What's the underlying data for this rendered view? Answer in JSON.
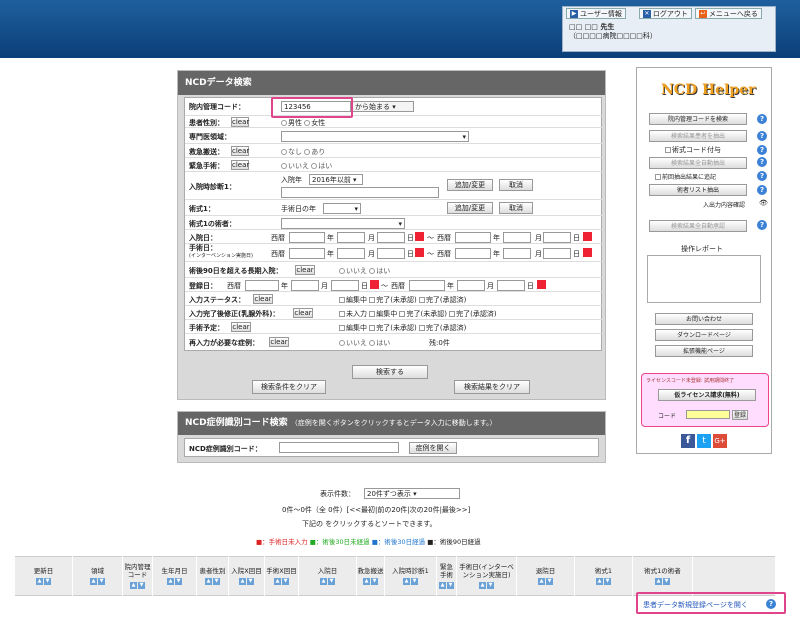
{
  "user": {
    "info_label": "ユーザー情報",
    "logout_label": "ログアウト",
    "menu_back_label": "メニューへ戻る",
    "name": "□□ □□ 先生",
    "hospital": "（□□□□病院□□□□科）"
  },
  "search": {
    "title": "NCDデータ検索",
    "hospital_code_label": "院内管理コード：",
    "hospital_code_value": "123456",
    "match_mode": "から始まる",
    "gender_label": "患者性別：",
    "clear": "clear",
    "male": "男性",
    "female": "女性",
    "specialty_label": "専門医領域：",
    "emergency_label": "救急搬送：",
    "none": "なし",
    "exists": "あり",
    "emergency_surgery_label": "緊急手術：",
    "no": "いいえ",
    "yes": "はい",
    "admission_diag_label": "入院時診断1：",
    "admission_year_label": "入院年",
    "admission_year_value": "2016年以前",
    "add_change": "追加/変更",
    "cancel": "取消",
    "procedure_label": "術式1：",
    "surgery_year_label": "手術日の年",
    "surgeon_label": "術式1の術者：",
    "admit_date_label": "入院日：",
    "seireki": "西暦",
    "year": "年",
    "month": "月",
    "day": "日",
    "tilde": "〜",
    "surgery_date_label": "手術日：",
    "surgery_date_sub": "(インターベンション実施日)",
    "long_stay_label": "術後90日を超える長期入院：",
    "reg_date_label": "登録日：",
    "input_status_label": "入力ステータス：",
    "editing": "編集中",
    "done_unapproved": "完了(未承認)",
    "done_approved": "完了(承認済)",
    "revision_label": "入力完了後修正(乳腺外科)：",
    "not_input": "未入力",
    "planned_label": "手術予定：",
    "reinput_label": "再入力が必要な症例：",
    "remaining": "残:0件",
    "search_button": "検索する",
    "clear_conditions": "検索条件をクリア",
    "clear_results": "検索結果をクリア"
  },
  "case_code": {
    "title": "NCD症例識別コード検索",
    "hint": "（症例を開くボタンをクリックするとデータ入力に移動します。）",
    "label": "NCD症例識別コード：",
    "open_button": "症例を開く"
  },
  "results": {
    "display_count_label": "表示件数：",
    "display_count_value": "20件ずつ表示",
    "summary": "0件〜0件（全 0件）[<<最初|前の20件|次の20件|最後>>]",
    "sort_hint": "下記の をクリックするとソートできます。",
    "legend": [
      "■：手術日未入力",
      "■：術後30日未経過",
      "■：術後30日経過",
      "■：術後90日経過"
    ],
    "headers": [
      "更新日",
      "領域",
      "院内管理コード",
      "生年月日",
      "患者性別",
      "入院X回目",
      "手術X回目",
      "入院日",
      "救急搬送",
      "入院時診断1",
      "緊急手術",
      "手術日(インターベンション実施日)",
      "退院日",
      "術式1",
      "術式1の術者"
    ],
    "new_patient_link": "患者データ新規登録ページを開く"
  },
  "helper": {
    "logo": "NCD Helper",
    "search_code": "院内管理コードを検索",
    "extract": "検索結果患者を抽出",
    "attach_code": "術式コード付与",
    "auto_extract": "検索結果全自動抽出",
    "append_note": "前回抽出結果に追記",
    "list_extract": "術者リスト抽出",
    "check_label": "入出力内容確認",
    "all_auto": "検索結果全自動承認",
    "report_label": "操作レポート",
    "contact": "お問い合わせ",
    "download": "ダウンロードページ",
    "ext_page": "拡張機能ページ",
    "license_note": "ライセンスコード未登録: 試用期間终了",
    "license_request": "仮ライセンス請求(無料)",
    "code_label": "コード",
    "register": "登録",
    "colors": {
      "accent": "#3b82d6",
      "logo": "#f0a020"
    }
  }
}
